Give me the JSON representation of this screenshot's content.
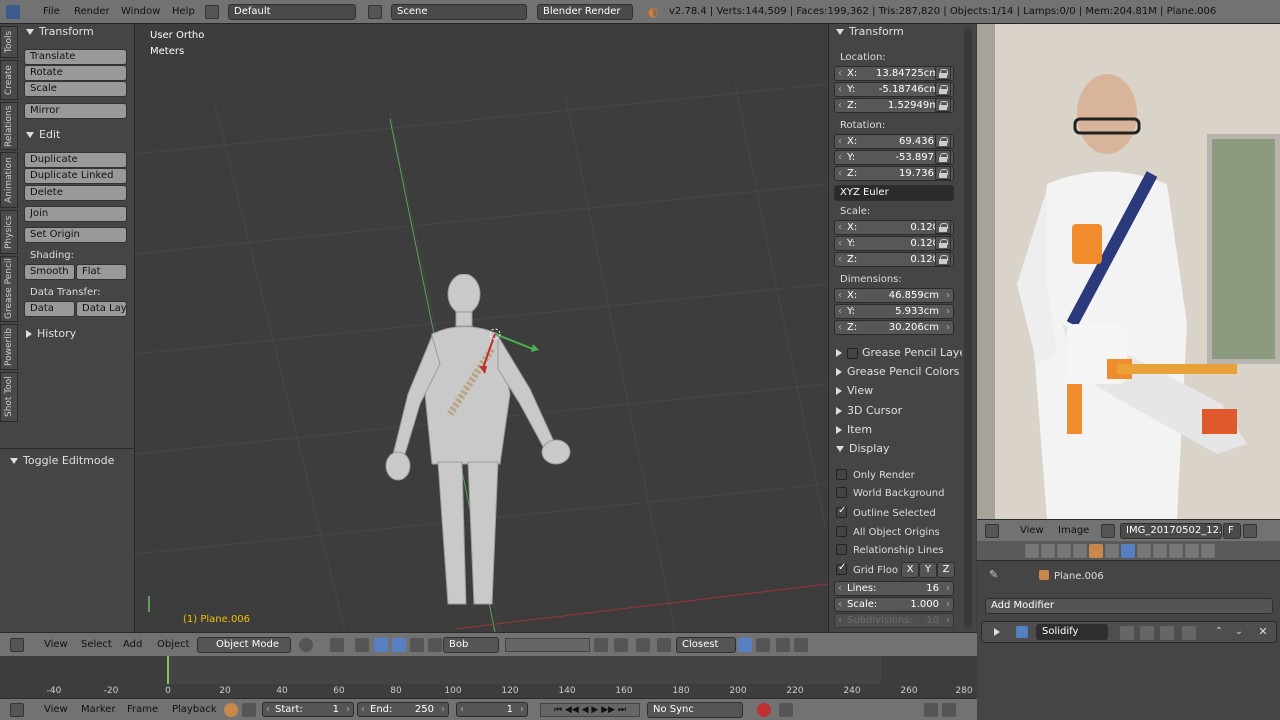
{
  "topbar": {
    "menus": [
      "File",
      "Render",
      "Window",
      "Help"
    ],
    "layout": "Default",
    "scene": "Scene",
    "engine": "Blender Render",
    "stats": "v2.78.4 | Verts:144,509 | Faces:199,362 | Tris:287,820 | Objects:1/14 | Lamps:0/0 | Mem:204.81M | Plane.006"
  },
  "toolshelf": {
    "tabs": [
      "Tools",
      "Create",
      "Relations",
      "Animation",
      "Physics",
      "Grease Pencil",
      "Powerlib",
      "Shot Tool"
    ],
    "transform_title": "Transform",
    "translate": "Translate",
    "rotate": "Rotate",
    "scale": "Scale",
    "mirror": "Mirror",
    "edit_title": "Edit",
    "duplicate": "Duplicate",
    "duplicate_linked": "Duplicate Linked",
    "delete": "Delete",
    "join": "Join",
    "set_origin": "Set Origin",
    "shading_label": "Shading:",
    "smooth": "Smooth",
    "flat": "Flat",
    "data_transfer_label": "Data Transfer:",
    "data": "Data",
    "data_layout": "Data Layo",
    "history_title": "History",
    "toggle_editmode": "Toggle Editmode"
  },
  "viewport": {
    "view_name": "User Ortho",
    "units": "Meters",
    "object_label": "(1) Plane.006"
  },
  "properties": {
    "transform_title": "Transform",
    "location_label": "Location:",
    "location": [
      {
        "k": "X:",
        "v": "13.84725cm"
      },
      {
        "k": "Y:",
        "v": "-5.18746cm"
      },
      {
        "k": "Z:",
        "v": "1.52949m"
      }
    ],
    "rotation_label": "Rotation:",
    "rotation": [
      {
        "k": "X:",
        "v": "69.436°"
      },
      {
        "k": "Y:",
        "v": "-53.897°"
      },
      {
        "k": "Z:",
        "v": "19.736°"
      }
    ],
    "rotation_mode": "XYZ Euler",
    "scale_label": "Scale:",
    "scale": [
      {
        "k": "X:",
        "v": "0.120"
      },
      {
        "k": "Y:",
        "v": "0.120"
      },
      {
        "k": "Z:",
        "v": "0.120"
      }
    ],
    "dimensions_label": "Dimensions:",
    "dimensions": [
      {
        "k": "X:",
        "v": "46.859cm"
      },
      {
        "k": "Y:",
        "v": "5.933cm"
      },
      {
        "k": "Z:",
        "v": "30.206cm"
      }
    ],
    "collapsed": [
      "Grease Pencil Layers",
      "Grease Pencil Colors",
      "View",
      "3D Cursor",
      "Item"
    ],
    "display_title": "Display",
    "only_render": "Only Render",
    "world_background": "World Background",
    "outline_selected": "Outline Selected",
    "all_object_origins": "All Object Origins",
    "relationship_lines": "Relationship Lines",
    "grid_floor": "Grid Floo",
    "axis_x": "X",
    "axis_y": "Y",
    "axis_z": "Z",
    "lines_key": "Lines:",
    "lines_val": "16",
    "gscale_key": "Scale:",
    "gscale_val": "1.000",
    "subdiv_key": "Subdivisions:",
    "subdiv_val": "10"
  },
  "image_editor": {
    "view": "View",
    "image": "Image",
    "image_name": "IMG_20170502_12...",
    "f_label": "F"
  },
  "modifier": {
    "object": "Plane.006",
    "add_modifier": "Add Modifier",
    "modifier_name": "Solidify"
  },
  "viewport_header": {
    "view": "View",
    "select": "Select",
    "add": "Add",
    "object": "Object",
    "mode": "Object Mode",
    "layer_name": "Bob",
    "snap": "Closest"
  },
  "timeline": {
    "ticks": [
      "-40",
      "-20",
      "0",
      "20",
      "40",
      "60",
      "80",
      "100",
      "120",
      "140",
      "160",
      "180",
      "200",
      "220",
      "240",
      "260",
      "280"
    ],
    "view": "View",
    "marker": "Marker",
    "frame": "Frame",
    "playback": "Playback",
    "start_label": "Start:",
    "start_val": "1",
    "end_label": "End:",
    "end_val": "250",
    "current": "1",
    "sync": "No Sync"
  },
  "colors": {
    "accent": "#5680c2",
    "grid_x": "#b03030",
    "grid_y": "#5aa05a",
    "playhead": "#7ec46b"
  }
}
